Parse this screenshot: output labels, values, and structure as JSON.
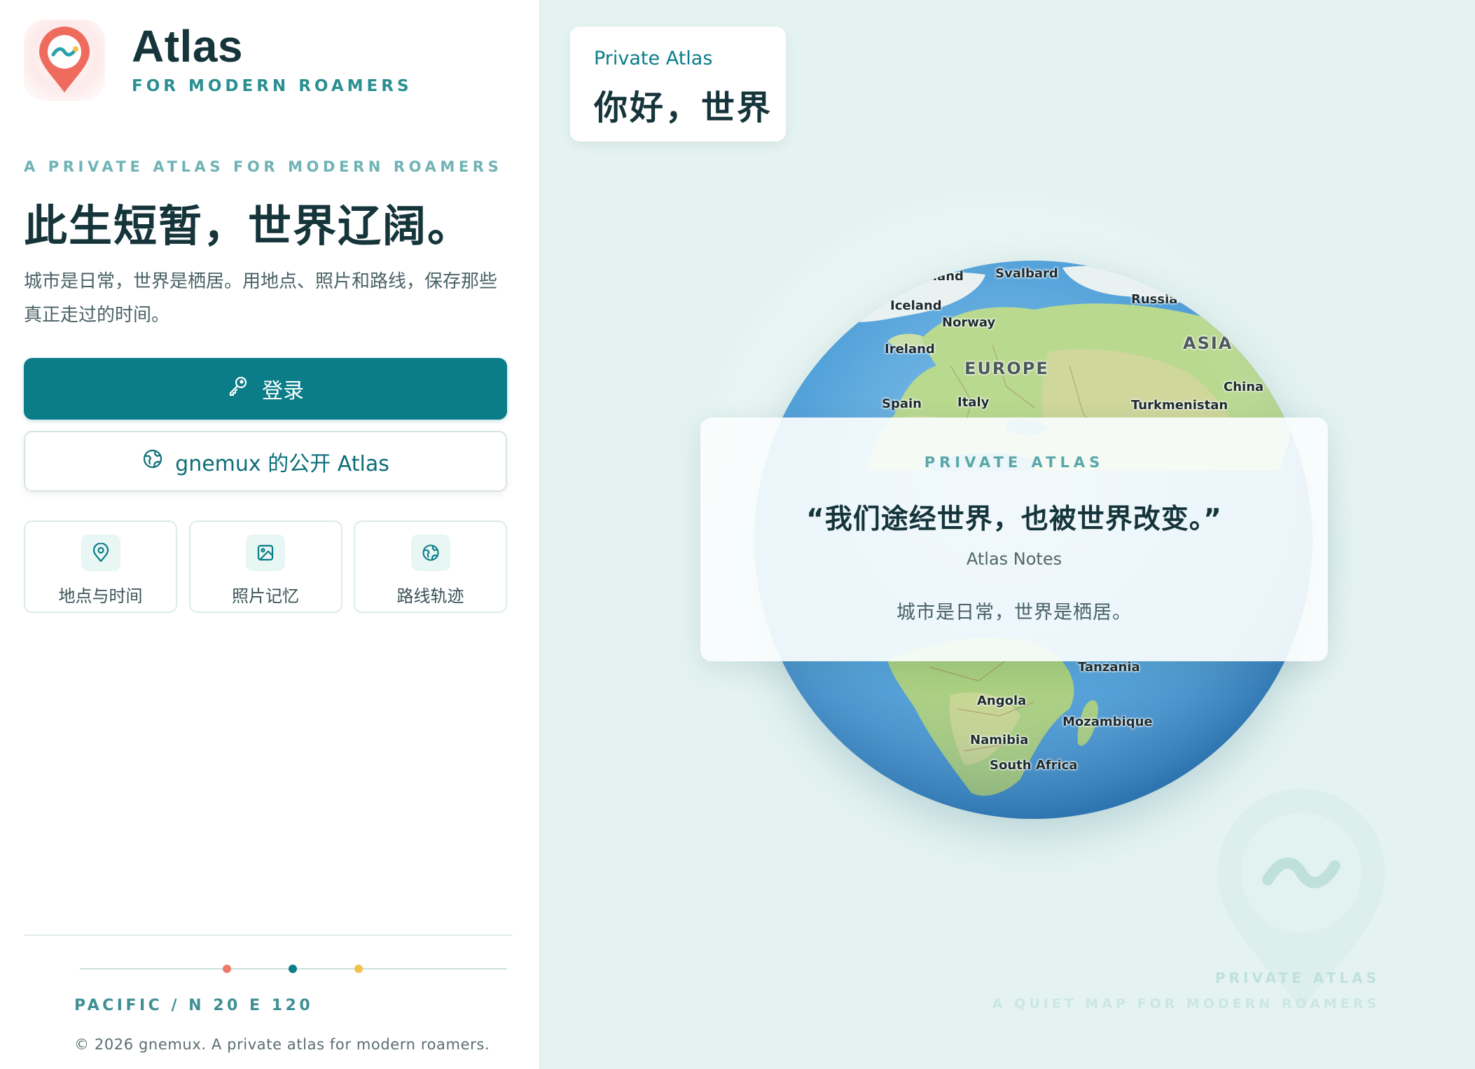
{
  "brand": {
    "title": "Atlas",
    "subtitle": "FOR MODERN ROAMERS",
    "logo_icon": "map-pin-wave-icon"
  },
  "hero": {
    "eyebrow": "A PRIVATE ATLAS FOR MODERN ROAMERS",
    "headline": "此生短暂，世界辽阔。",
    "intro": "城市是日常，世界是栖居。用地点、照片和路线，保存那些真正走过的时间。"
  },
  "actions": {
    "login_label": "登录",
    "login_icon": "key-icon",
    "public_label": "gnemux 的公开 Atlas",
    "public_icon": "globe-icon"
  },
  "features": [
    {
      "label": "地点与时间",
      "icon": "map-pin-icon"
    },
    {
      "label": "照片记忆",
      "icon": "image-icon"
    },
    {
      "label": "路线轨迹",
      "icon": "globe-icon"
    }
  ],
  "footer": {
    "coordinates": "PACIFIC / N 20 E 120",
    "copyright": "© 2026 gnemux. A private atlas for modern roamers.",
    "dot_colors": [
      "#ee7a6a",
      "#0a7d88",
      "#f2c14e"
    ]
  },
  "greeting": {
    "tag": "Private Atlas",
    "text": "你好，世界"
  },
  "globe_labels": {
    "greenland": "Greenland",
    "svalbard": "Svalbard",
    "iceland": "Iceland",
    "russia": "Russia",
    "norway": "Norway",
    "asia": "ASIA",
    "ireland": "Ireland",
    "europe": "EUROPE",
    "china": "China",
    "spain": "Spain",
    "italy": "Italy",
    "turkmenistan": "Turkmenistan",
    "tanzania": "Tanzania",
    "angola": "Angola",
    "mozambique": "Mozambique",
    "namibia": "Namibia",
    "south_africa": "South Africa"
  },
  "quote_card": {
    "eyebrow": "PRIVATE ATLAS",
    "quote": "“我们途经世界，也被世界改变。”",
    "author": "Atlas Notes",
    "line": "城市是日常，世界是栖居。"
  },
  "watermark": {
    "title": "PRIVATE ATLAS",
    "subtitle": "A QUIET MAP FOR MODERN ROAMERS"
  },
  "colors": {
    "accent": "#0a7d88",
    "heading": "#15353b",
    "logo_pin": "#ee6b5e"
  }
}
